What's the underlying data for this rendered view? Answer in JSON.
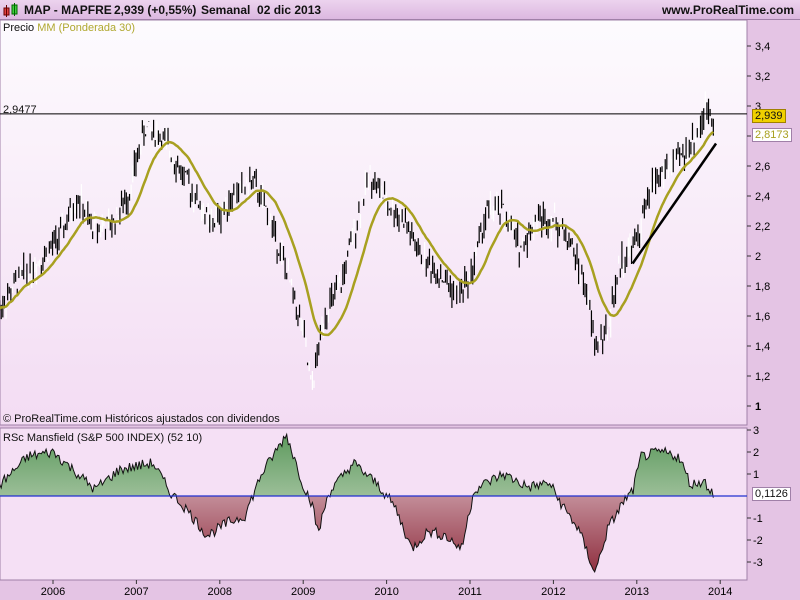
{
  "header": {
    "symbol": "MAP - MAPFRE",
    "price": "2,939 (+0,55%)",
    "period": "Semanal  02 dic 2013",
    "site": "www.ProRealTime.com"
  },
  "price_panel": {
    "label_price": "Precio",
    "label_ma": "MM (Ponderada 30)",
    "hline_label": "2,9477",
    "last_price": "2,939",
    "last_ma": "2,8173",
    "footer": "© ProRealTime.com  Históricos ajustados con dividendos",
    "yticks": [
      "3,4",
      "3,2",
      "3",
      "2,8",
      "2,6",
      "2,4",
      "2,2",
      "2",
      "1,8",
      "1,6",
      "1,4",
      "1,2",
      "1"
    ],
    "ma_color": "#a8a020"
  },
  "rsc_panel": {
    "label": "RSc Mansfield (S&P 500 INDEX) (52 10)",
    "last_value": "0,1126",
    "yticks": [
      "3",
      "2",
      "1",
      "-1",
      "-2",
      "-3"
    ]
  },
  "xaxis": {
    "ticks": [
      "2006",
      "2007",
      "2008",
      "2009",
      "2010",
      "2011",
      "2012",
      "2013",
      "2014"
    ]
  },
  "chart_data": {
    "type": "ohlc",
    "price_anchor_points": [
      [
        2005.36,
        1.65
      ],
      [
        2005.6,
        1.85
      ],
      [
        2005.9,
        2.0
      ],
      [
        2006.1,
        2.15
      ],
      [
        2006.3,
        2.4
      ],
      [
        2006.45,
        2.2
      ],
      [
        2006.7,
        2.2
      ],
      [
        2006.9,
        2.4
      ],
      [
        2007.1,
        2.85
      ],
      [
        2007.3,
        2.8
      ],
      [
        2007.5,
        2.6
      ],
      [
        2007.7,
        2.4
      ],
      [
        2007.9,
        2.2
      ],
      [
        2008.15,
        2.4
      ],
      [
        2008.4,
        2.5
      ],
      [
        2008.6,
        2.25
      ],
      [
        2008.8,
        1.9
      ],
      [
        2009.0,
        1.5
      ],
      [
        2009.1,
        1.1
      ],
      [
        2009.25,
        1.6
      ],
      [
        2009.45,
        1.8
      ],
      [
        2009.65,
        2.25
      ],
      [
        2009.8,
        2.55
      ],
      [
        2010.0,
        2.35
      ],
      [
        2010.2,
        2.25
      ],
      [
        2010.4,
        2.0
      ],
      [
        2010.6,
        1.9
      ],
      [
        2010.85,
        1.75
      ],
      [
        2011.0,
        1.85
      ],
      [
        2011.2,
        2.3
      ],
      [
        2011.4,
        2.3
      ],
      [
        2011.6,
        2.05
      ],
      [
        2011.8,
        2.25
      ],
      [
        2012.0,
        2.25
      ],
      [
        2012.2,
        2.1
      ],
      [
        2012.4,
        1.75
      ],
      [
        2012.5,
        1.4
      ],
      [
        2012.65,
        1.5
      ],
      [
        2012.8,
        1.95
      ],
      [
        2013.0,
        2.1
      ],
      [
        2013.2,
        2.5
      ],
      [
        2013.4,
        2.6
      ],
      [
        2013.6,
        2.7
      ],
      [
        2013.75,
        2.85
      ],
      [
        2013.85,
        3.0
      ],
      [
        2013.92,
        2.94
      ]
    ],
    "rsc_anchor_points": [
      [
        2005.36,
        0.5
      ],
      [
        2005.7,
        1.8
      ],
      [
        2006.0,
        2.0
      ],
      [
        2006.3,
        1.0
      ],
      [
        2006.5,
        0.3
      ],
      [
        2006.8,
        1.2
      ],
      [
        2007.2,
        1.5
      ],
      [
        2007.4,
        0.2
      ],
      [
        2007.6,
        -0.6
      ],
      [
        2007.85,
        -1.8
      ],
      [
        2008.1,
        -1.2
      ],
      [
        2008.3,
        -0.9
      ],
      [
        2008.5,
        1.0
      ],
      [
        2008.8,
        2.8
      ],
      [
        2009.0,
        0.5
      ],
      [
        2009.1,
        -0.3
      ],
      [
        2009.18,
        -1.7
      ],
      [
        2009.3,
        0.1
      ],
      [
        2009.6,
        1.5
      ],
      [
        2009.9,
        0.5
      ],
      [
        2010.1,
        -0.5
      ],
      [
        2010.3,
        -2.4
      ],
      [
        2010.5,
        -1.6
      ],
      [
        2010.7,
        -1.8
      ],
      [
        2010.9,
        -2.4
      ],
      [
        2011.05,
        0.3
      ],
      [
        2011.4,
        1.0
      ],
      [
        2011.7,
        0.4
      ],
      [
        2011.95,
        0.6
      ],
      [
        2012.1,
        -0.4
      ],
      [
        2012.3,
        -1.5
      ],
      [
        2012.5,
        -3.5
      ],
      [
        2012.65,
        -1.5
      ],
      [
        2012.85,
        -0.2
      ],
      [
        2012.95,
        0.2
      ],
      [
        2013.05,
        1.8
      ],
      [
        2013.3,
        2.0
      ],
      [
        2013.5,
        1.8
      ],
      [
        2013.65,
        0.5
      ],
      [
        2013.8,
        0.7
      ],
      [
        2013.92,
        0.11
      ]
    ],
    "trendline": [
      [
        2012.95,
        1.95
      ],
      [
        2013.95,
        2.75
      ]
    ],
    "hline": 2.9477,
    "price_ylim": [
      1,
      3.5
    ],
    "rsc_ylim": [
      -3.6,
      3.2
    ],
    "xlim": [
      2005.36,
      2014.27
    ]
  }
}
